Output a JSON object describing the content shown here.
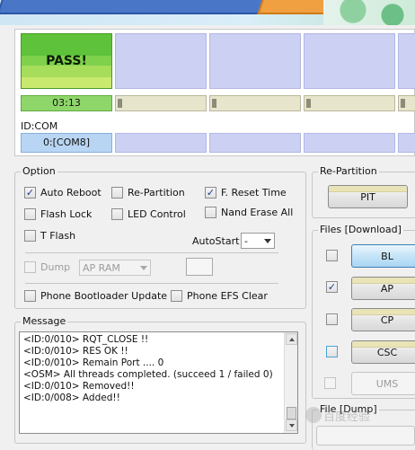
{
  "ports": {
    "status_text": "PASS!",
    "elapsed_time": "03:13",
    "id_com_label": "ID:COM",
    "com_port": "0:[COM8]"
  },
  "option": {
    "title": "Option",
    "auto_reboot": {
      "label": "Auto Reboot",
      "checked": true
    },
    "re_partition": {
      "label": "Re-Partition",
      "checked": false
    },
    "f_reset_time": {
      "label": "F. Reset Time",
      "checked": true
    },
    "flash_lock": {
      "label": "Flash Lock",
      "checked": false
    },
    "led_control": {
      "label": "LED Control",
      "checked": false
    },
    "nand_erase_all": {
      "label": "Nand Erase All",
      "checked": false
    },
    "t_flash": {
      "label": "T Flash",
      "checked": false
    },
    "autostart_label": "AutoStart",
    "autostart_value": "-",
    "dump": {
      "label": "Dump",
      "checked": false
    },
    "dump_select": "AP RAM",
    "phone_bootloader_update": {
      "label": "Phone Bootloader Update",
      "checked": false
    },
    "phone_efs_clear": {
      "label": "Phone EFS Clear",
      "checked": false
    }
  },
  "message": {
    "title": "Message",
    "lines": [
      "<ID:0/010> RQT_CLOSE !!",
      "<ID:0/010> RES OK !!",
      "<ID:0/010> Remain Port ....  0",
      "<OSM> All threads completed. (succeed 1 / failed 0)",
      "<ID:0/010> Removed!!",
      "<ID:0/008> Added!!"
    ]
  },
  "re_partition_panel": {
    "title": "Re-Partition",
    "pit_label": "PIT"
  },
  "files": {
    "title": "Files [Download]",
    "bl": {
      "label": "BL",
      "checked": false
    },
    "ap": {
      "label": "AP",
      "checked": true
    },
    "cp": {
      "label": "CP",
      "checked": false
    },
    "csc": {
      "label": "CSC",
      "checked": false
    },
    "ums": {
      "label": "UMS",
      "checked": false
    }
  },
  "file_dump": {
    "title": "File [Dump]"
  },
  "watermark": {
    "text": "百度经验"
  }
}
